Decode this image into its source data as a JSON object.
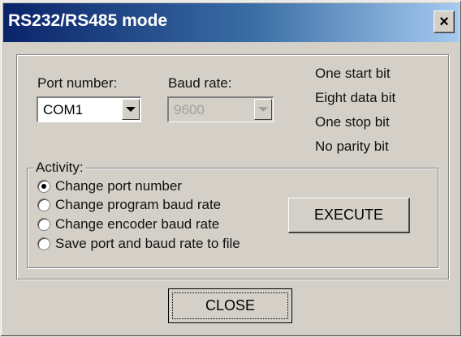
{
  "window": {
    "title": "RS232/RS485 mode",
    "close_glyph": "×"
  },
  "port": {
    "label": "Port number:",
    "value": "COM1"
  },
  "baud": {
    "label": "Baud rate:",
    "value": "9600",
    "disabled": true
  },
  "serial_info": [
    "One start bit",
    "Eight data bit",
    "One stop bit",
    "No parity bit"
  ],
  "activity": {
    "legend": "Activity:",
    "options": [
      {
        "label": "Change port number",
        "checked": true
      },
      {
        "label": "Change program baud rate",
        "checked": false
      },
      {
        "label": "Change encoder baud rate",
        "checked": false
      },
      {
        "label": "Save port and baud rate to file",
        "checked": false
      }
    ]
  },
  "buttons": {
    "execute": "EXECUTE",
    "close": "CLOSE"
  },
  "colors": {
    "face": "#d4d0c8",
    "title_start": "#0a246a",
    "title_end": "#a6caf0"
  }
}
